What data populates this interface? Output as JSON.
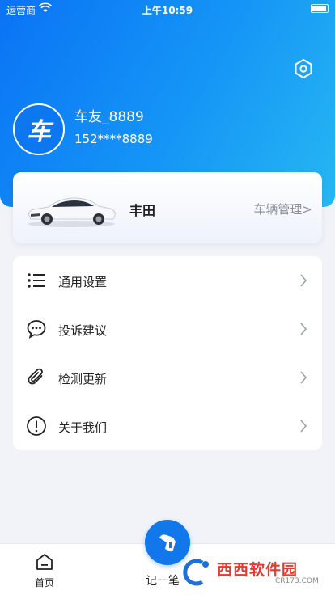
{
  "status_bar": {
    "carrier": "运营商",
    "time": "上午10:59"
  },
  "profile": {
    "avatar_char": "车",
    "username": "车友_8889",
    "phone": "152****8889"
  },
  "car": {
    "name": "丰田",
    "manage_label": "车辆管理>"
  },
  "menu": {
    "items": [
      {
        "label": "通用设置",
        "icon": "list-icon"
      },
      {
        "label": "投诉建议",
        "icon": "message-icon"
      },
      {
        "label": "检测更新",
        "icon": "paperclip-icon"
      },
      {
        "label": "关于我们",
        "icon": "info-icon"
      }
    ]
  },
  "tabbar": {
    "home_label": "首页",
    "record_label": "记一笔"
  },
  "watermark": {
    "text": "西西软件园",
    "sub": "CR173.COM"
  },
  "colors": {
    "primary": "#1177ea",
    "header_gradient_start": "#0a73f5",
    "header_gradient_end": "#27b7f2"
  }
}
